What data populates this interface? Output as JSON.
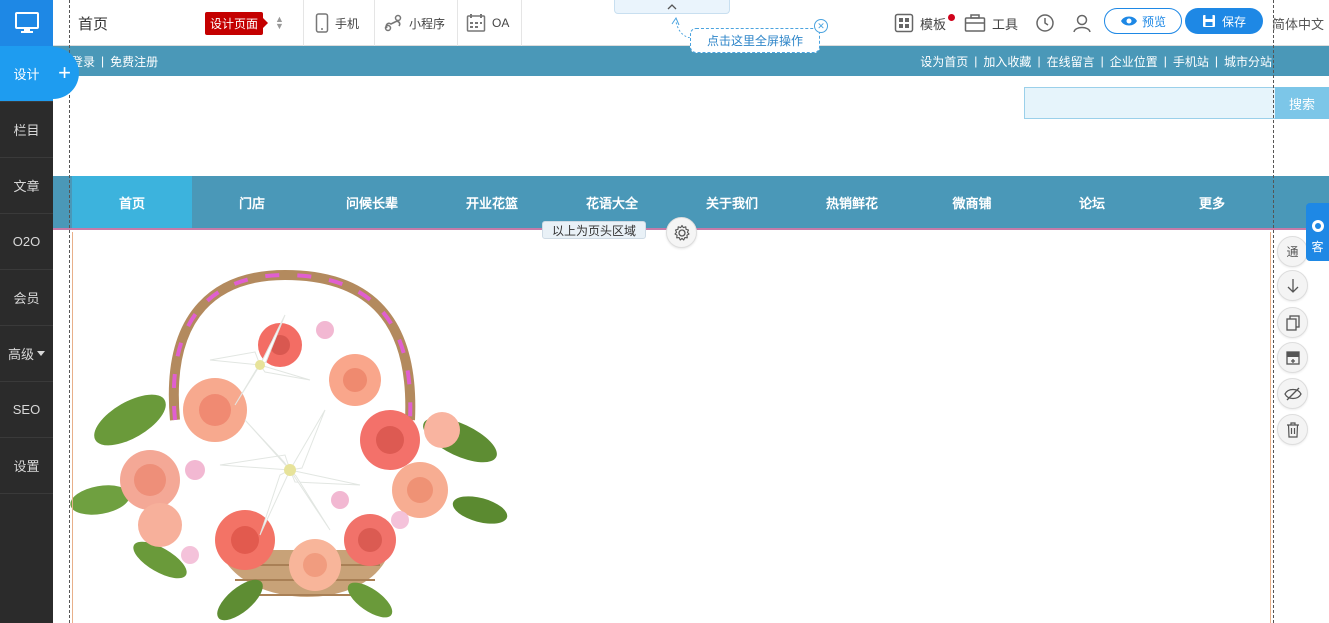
{
  "sidebar": {
    "items": [
      {
        "label": "设计"
      },
      {
        "label": "栏目"
      },
      {
        "label": "文章"
      },
      {
        "label": "O2O"
      },
      {
        "label": "会员"
      },
      {
        "label": "高级"
      },
      {
        "label": "SEO"
      },
      {
        "label": "设置"
      }
    ],
    "add_label": "+"
  },
  "toolbar": {
    "page_name": "首页",
    "page_tag": "设计页面",
    "mobile": "手机",
    "miniprogram": "小程序",
    "oa": "OA",
    "template": "模板",
    "tools": "工具",
    "preview": "预览",
    "save": "保存",
    "language": "简体中文"
  },
  "fullscreen_tip": "点击这里全屏操作",
  "site": {
    "top_left": [
      "登录",
      "免费注册"
    ],
    "top_right": [
      "设为首页",
      "加入收藏",
      "在线留言",
      "企业位置",
      "手机站",
      "城市分站"
    ],
    "search_button": "搜索",
    "nav": [
      "首页",
      "门店",
      "问候长辈",
      "开业花篮",
      "花语大全",
      "关于我们",
      "热销鲜花",
      "微商铺",
      "论坛",
      "更多"
    ],
    "header_label": "以上为页头区域"
  },
  "right_tools": {
    "first_label": "通",
    "service_label": "客"
  },
  "colors": {
    "accent": "#1e88e5",
    "site_bar": "#4a98b8",
    "nav_active": "#3cb3dd",
    "tag_red": "#c40000"
  }
}
